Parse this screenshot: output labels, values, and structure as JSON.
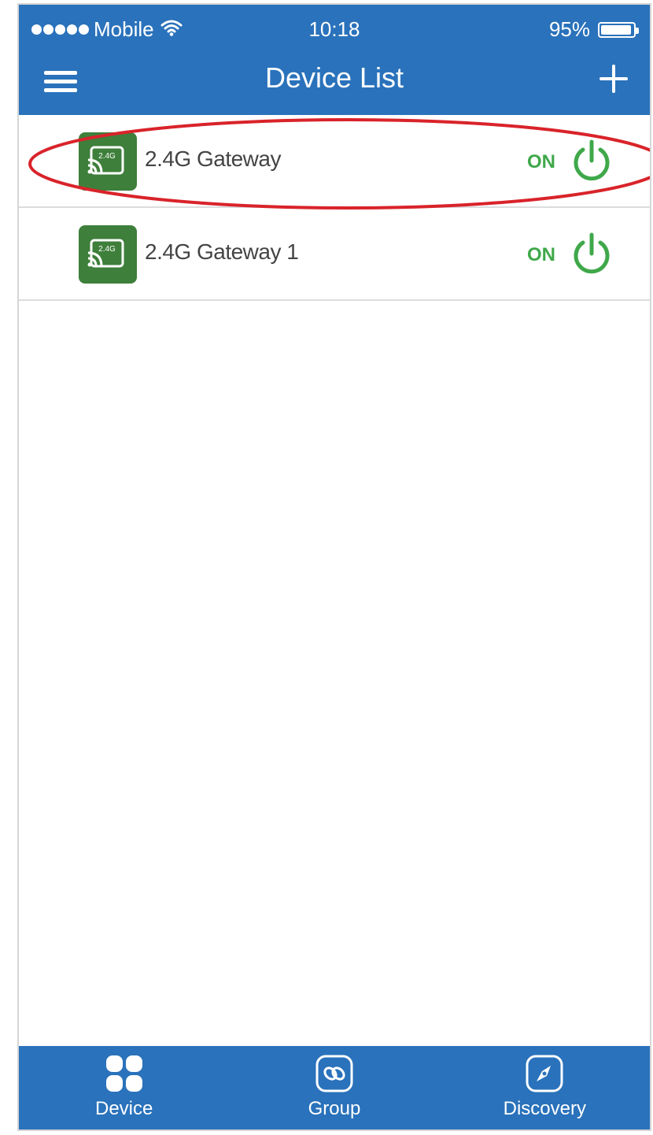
{
  "status_bar": {
    "carrier": "Mobile",
    "time": "10:18",
    "battery": "95%",
    "battery_level": 0.95
  },
  "nav": {
    "title": "Device List",
    "menu_icon": "hamburger-menu-icon",
    "add_icon": "plus-icon"
  },
  "devices": [
    {
      "name": "2.4G Gateway",
      "state": "ON",
      "icon": "gateway-icon",
      "icon_label": "2.4G",
      "highlighted": true
    },
    {
      "name": "2.4G Gateway 1",
      "state": "ON",
      "icon": "gateway-icon",
      "icon_label": "2.4G",
      "highlighted": false
    }
  ],
  "tabs": [
    {
      "label": "Device",
      "icon": "grid-icon"
    },
    {
      "label": "Group",
      "icon": "group-link-icon"
    },
    {
      "label": "Discovery",
      "icon": "compass-icon"
    }
  ],
  "colors": {
    "primary": "#2a72bb",
    "on_green": "#3fa84a",
    "device_icon_bg": "#3e7f3b",
    "highlight_red": "#d9232a"
  }
}
